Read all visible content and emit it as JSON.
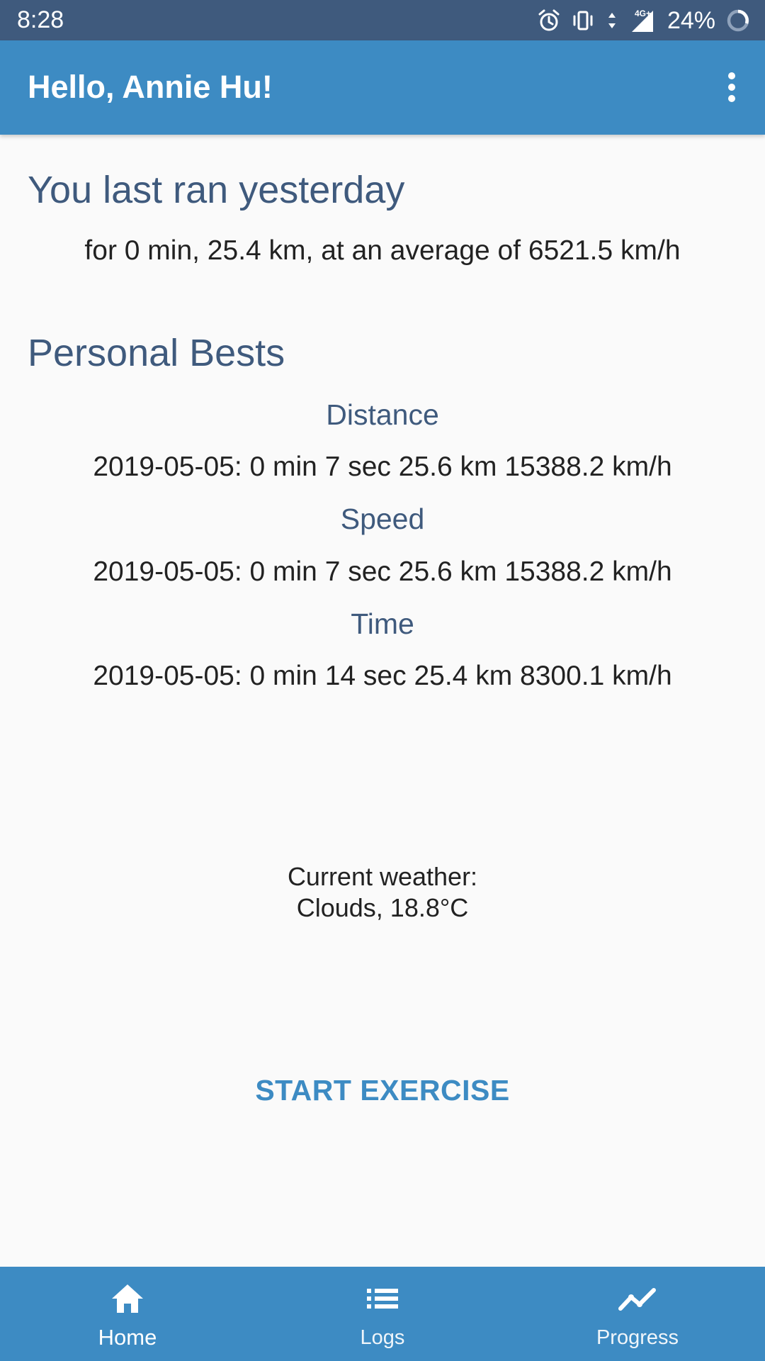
{
  "status_bar": {
    "time": "8:28",
    "network": "4G+",
    "battery": "24%",
    "icons": [
      "alarm-icon",
      "vibrate-icon",
      "data-arrows-icon",
      "signal-icon",
      "battery-icon"
    ]
  },
  "app_bar": {
    "title": "Hello, Annie Hu!",
    "menu_icon": "more-vert-icon"
  },
  "last_run": {
    "heading": "You last ran yesterday",
    "detail": "for 0 min, 25.4 km, at an average of 6521.5 km/h"
  },
  "personal_bests": {
    "heading": "Personal Bests",
    "items": [
      {
        "label": "Distance",
        "value": "2019-05-05: 0 min 7 sec 25.6 km 15388.2 km/h"
      },
      {
        "label": "Speed",
        "value": "2019-05-05: 0 min 7 sec 25.6 km 15388.2 km/h"
      },
      {
        "label": "Time",
        "value": "2019-05-05: 0 min 14 sec 25.4 km 8300.1 km/h"
      }
    ]
  },
  "weather": {
    "label": "Current weather:",
    "value": "Clouds, 18.8°C"
  },
  "start_button": {
    "label": "START EXERCISE"
  },
  "bottom_nav": {
    "items": [
      {
        "label": "Home",
        "icon": "home-icon",
        "active": true
      },
      {
        "label": "Logs",
        "icon": "list-icon",
        "active": false
      },
      {
        "label": "Progress",
        "icon": "trending-icon",
        "active": false
      }
    ]
  },
  "colors": {
    "primary": "#3d8bc3",
    "status_bar": "#3f5a7d",
    "heading_text": "#3f5a7d",
    "body_text": "#222222",
    "background": "#fafafa"
  }
}
